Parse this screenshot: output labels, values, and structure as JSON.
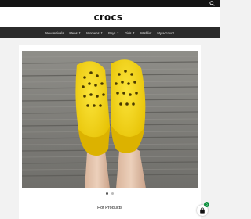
{
  "topbar": {
    "search_icon": "search-icon"
  },
  "header": {
    "logo_text": "crocs",
    "logo_mark": "™"
  },
  "nav": {
    "items": [
      {
        "label": "New Arrivals",
        "has_dropdown": false
      },
      {
        "label": "Mens",
        "has_dropdown": true
      },
      {
        "label": "Womens",
        "has_dropdown": true
      },
      {
        "label": "Boys",
        "has_dropdown": true
      },
      {
        "label": "Girls",
        "has_dropdown": true
      },
      {
        "label": "Wishlist",
        "has_dropdown": false
      },
      {
        "label": "My account",
        "has_dropdown": false
      }
    ],
    "dropdown_icon": "chevron-down-icon"
  },
  "hero": {
    "image": "yellow-crocs-clogs-on-wooden-deck",
    "slides": 2,
    "active_slide": 1
  },
  "section": {
    "title": "Hot Products"
  },
  "cart": {
    "icon": "shopping-bag-icon",
    "count": "0"
  },
  "colors": {
    "topbar": "#141414",
    "nav": "#2b2b2b",
    "clog_yellow": "#f5d40a",
    "badge": "#0a8f3c"
  }
}
